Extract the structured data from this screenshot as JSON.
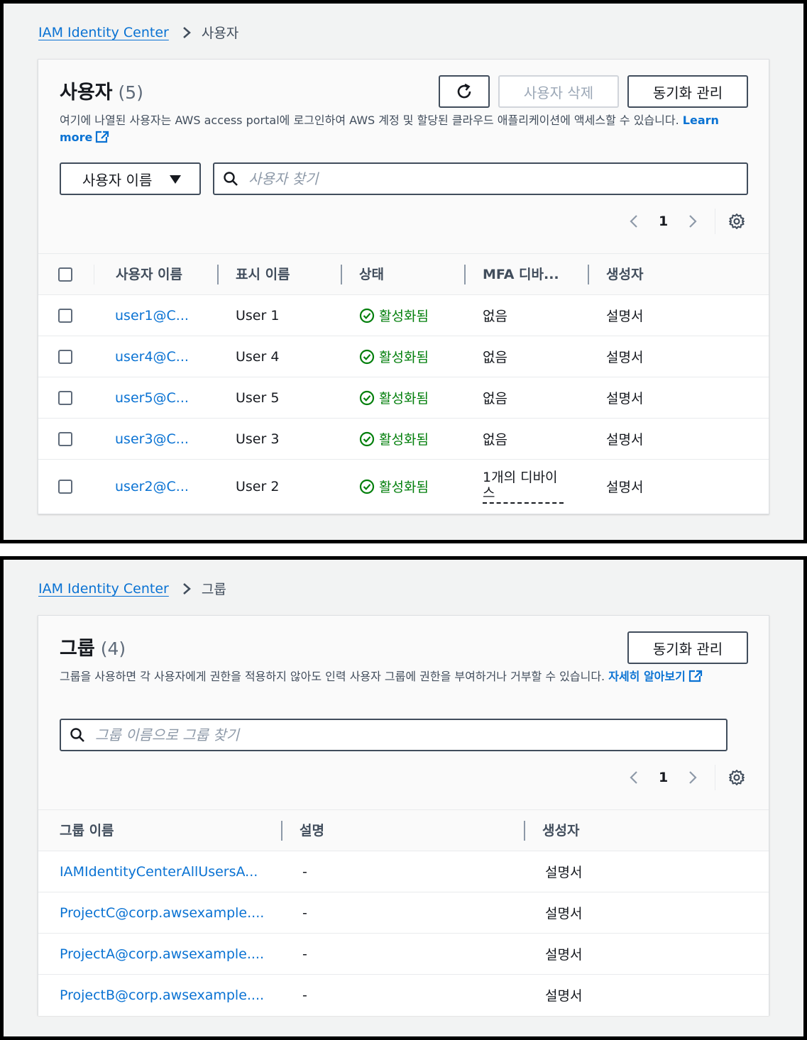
{
  "users_page": {
    "breadcrumb": {
      "root": "IAM Identity Center",
      "current": "사용자"
    },
    "title": "사용자",
    "count": "(5)",
    "buttons": {
      "delete": "사용자 삭제",
      "sync": "동기화 관리"
    },
    "description": "여기에 나열된 사용자는 AWS access portal에 로그인하여 AWS 계정 및 할당된 클라우드 애플리케이션에 액세스할 수 있습니다.",
    "learn_more": "Learn more",
    "filter": {
      "selected": "사용자 이름"
    },
    "search": {
      "placeholder": "사용자 찾기"
    },
    "pagination": {
      "page": "1"
    },
    "columns": [
      "사용자 이름",
      "표시 이름",
      "상태",
      "MFA 디바...",
      "생성자"
    ],
    "rows": [
      {
        "username": "user1@C...",
        "display": "User 1",
        "status": "활성화됨",
        "mfa": "없음",
        "created_by": "설명서"
      },
      {
        "username": "user4@C...",
        "display": "User 4",
        "status": "활성화됨",
        "mfa": "없음",
        "created_by": "설명서"
      },
      {
        "username": "user5@C...",
        "display": "User 5",
        "status": "활성화됨",
        "mfa": "없음",
        "created_by": "설명서"
      },
      {
        "username": "user3@C...",
        "display": "User 3",
        "status": "활성화됨",
        "mfa": "없음",
        "created_by": "설명서"
      },
      {
        "username": "user2@C...",
        "display": "User 2",
        "status": "활성화됨",
        "mfa": "1개의 디바이스",
        "created_by": "설명서"
      }
    ]
  },
  "groups_page": {
    "breadcrumb": {
      "root": "IAM Identity Center",
      "current": "그룹"
    },
    "title": "그룹",
    "count": "(4)",
    "buttons": {
      "sync": "동기화 관리"
    },
    "description": "그룹을 사용하면 각 사용자에게 권한을 적용하지 않아도 인력 사용자 그룹에 권한을 부여하거나 거부할 수 있습니다.",
    "learn_more": "자세히 알아보기",
    "search": {
      "placeholder": "그룹 이름으로 그룹 찾기"
    },
    "pagination": {
      "page": "1"
    },
    "columns": [
      "그룹 이름",
      "설명",
      "생성자"
    ],
    "rows": [
      {
        "name": "IAMIdentityCenterAllUsersA...",
        "description": "-",
        "created_by": "설명서"
      },
      {
        "name": "ProjectC@corp.awsexample....",
        "description": "-",
        "created_by": "설명서"
      },
      {
        "name": "ProjectA@corp.awsexample....",
        "description": "-",
        "created_by": "설명서"
      },
      {
        "name": "ProjectB@corp.awsexample....",
        "description": "-",
        "created_by": "설명서"
      }
    ]
  },
  "colors": {
    "link": "#0972d3",
    "success": "#037f0c",
    "border": "#414d5c",
    "background": "#f2f3f3"
  }
}
